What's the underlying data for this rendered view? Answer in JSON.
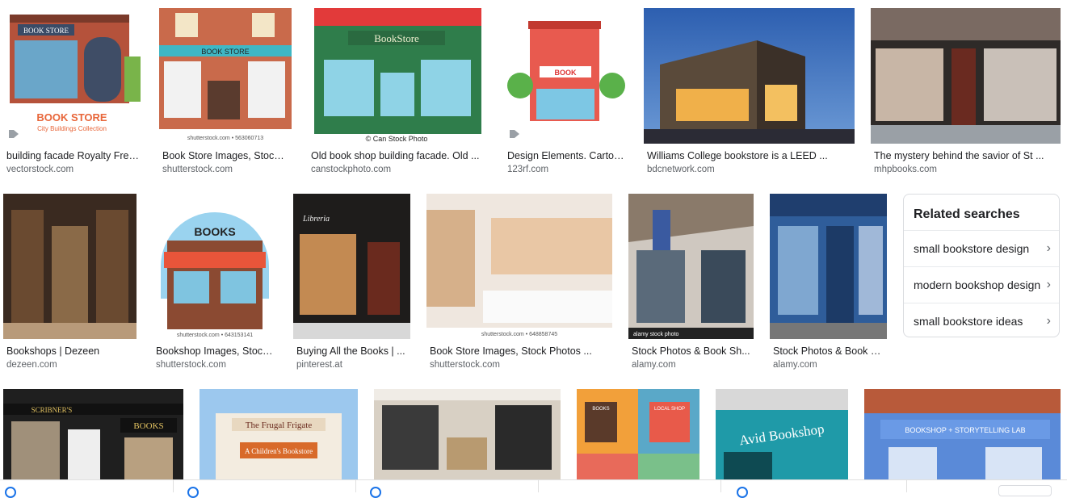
{
  "row1": [
    {
      "caption": "building facade Royalty Free...",
      "source": "vectorstock.com",
      "thumb_label": "BOOK STORE",
      "thumb_sub": "City Buildings Collection",
      "tag": true
    },
    {
      "caption": "Book Store Images, Stock ...",
      "source": "shutterstock.com",
      "thumb_label": "BOOK STORE",
      "thumb_sub": "shutterstock.com • 563060713",
      "tag": false
    },
    {
      "caption": "Old book shop building facade. Old ...",
      "source": "canstockphoto.com",
      "thumb_label": "BookStore",
      "thumb_sub": "© Can Stock Photo",
      "tag": false
    },
    {
      "caption": "Design Elements. Cartoo...",
      "source": "123rf.com",
      "thumb_label": "BOOK",
      "thumb_sub": "",
      "tag": true
    },
    {
      "caption": "Williams College bookstore is a LEED ...",
      "source": "bdcnetwork.com",
      "thumb_label": "",
      "thumb_sub": "",
      "tag": false
    },
    {
      "caption": "The mystery behind the savior of St ...",
      "source": "mhpbooks.com",
      "thumb_label": "",
      "thumb_sub": "",
      "tag": false
    }
  ],
  "row2": [
    {
      "caption": "Bookshops | Dezeen",
      "source": "dezeen.com",
      "thumb_label": "",
      "thumb_sub": ""
    },
    {
      "caption": "Bookshop Images, Stock...",
      "source": "shutterstock.com",
      "thumb_label": "BOOKS",
      "thumb_sub": "shutterstock.com • 643153141"
    },
    {
      "caption": "Buying All the Books | ...",
      "source": "pinterest.at",
      "thumb_label": "Libreria",
      "thumb_sub": ""
    },
    {
      "caption": "Book Store Images, Stock Photos ...",
      "source": "shutterstock.com",
      "thumb_label": "",
      "thumb_sub": "shutterstock.com • 648858745"
    },
    {
      "caption": "Stock Photos & Book Sh...",
      "source": "alamy.com",
      "thumb_label": "",
      "thumb_sub": "alamy stock photo"
    },
    {
      "caption": "Stock Photos & Book S...",
      "source": "alamy.com",
      "thumb_label": "",
      "thumb_sub": ""
    }
  ],
  "row3": [
    {
      "thumb_label": "SCRIBNER'S",
      "thumb_sub": "BOOKS"
    },
    {
      "thumb_label": "The Frugal Frigate",
      "thumb_sub": "A Children's Bookstore"
    },
    {
      "thumb_label": "",
      "thumb_sub": ""
    },
    {
      "thumb_label": "BOOKS",
      "thumb_sub": "LOCAL SHOP"
    },
    {
      "thumb_label": "Avid Bookshop",
      "thumb_sub": ""
    },
    {
      "thumb_label": "BOOKSHOP + STORYTELLING LAB",
      "thumb_sub": ""
    }
  ],
  "related": {
    "title": "Related searches",
    "items": [
      "small bookstore design",
      "modern bookshop design",
      "small bookstore ideas"
    ],
    "chevron": "chevron-right-icon"
  },
  "colors": {
    "caption": "#202124",
    "source": "#5f6368",
    "accent": "#1a73e8",
    "border": "#dadce0"
  }
}
